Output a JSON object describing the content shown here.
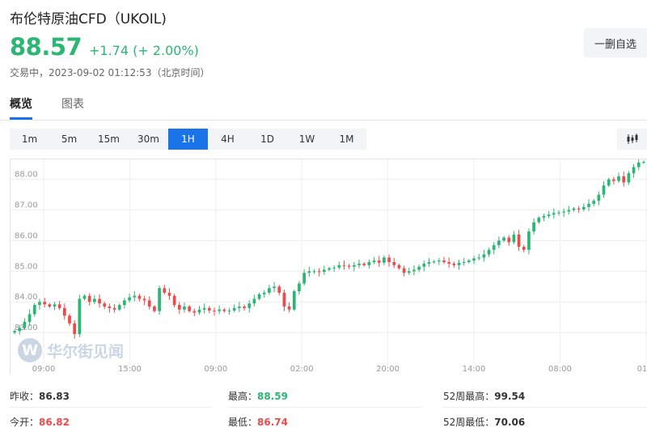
{
  "header": {
    "title": "布伦特原油CFD（UKOIL)",
    "price": "88.57",
    "change": "+1.74 (+ 2.00%)",
    "status": "交易中，2023-09-02 01:12:53（北京时间）",
    "watch_label": "一删自选"
  },
  "tabs": [
    {
      "label": "概览",
      "active": true
    },
    {
      "label": "图表",
      "active": false
    }
  ],
  "intervals": [
    {
      "label": "1m",
      "active": false
    },
    {
      "label": "5m",
      "active": false
    },
    {
      "label": "15m",
      "active": false
    },
    {
      "label": "30m",
      "active": false
    },
    {
      "label": "1H",
      "active": true
    },
    {
      "label": "4H",
      "active": false
    },
    {
      "label": "1D",
      "active": false
    },
    {
      "label": "1W",
      "active": false
    },
    {
      "label": "1M",
      "active": false
    }
  ],
  "chart_type_icon": "candlestick-chart-icon",
  "watermark": {
    "logo_letter": "W",
    "text": "华尔街见闻"
  },
  "colors": {
    "up": "#2bb673",
    "down": "#ef4a4a",
    "accent": "#1a73e8",
    "grid": "#eeeeee",
    "axis_text": "#999999"
  },
  "chart_data": {
    "type": "candlestick",
    "y_ticks": [
      "83.00",
      "84.00",
      "85.00",
      "86.00",
      "87.00",
      "88.00"
    ],
    "ylim": [
      82.0,
      88.6
    ],
    "x_ticks": [
      "09:00",
      "15:00",
      "09:00",
      "02:00",
      "20:00",
      "14:00",
      "08:00",
      "01:0"
    ],
    "grid": true,
    "closes": [
      83.05,
      83.15,
      83.35,
      83.6,
      83.9,
      84.0,
      83.92,
      83.85,
      83.92,
      83.8,
      83.55,
      83.3,
      82.95,
      84.1,
      84.2,
      84.0,
      84.1,
      83.95,
      83.85,
      83.8,
      83.75,
      83.9,
      84.05,
      84.15,
      84.2,
      84.1,
      84.05,
      83.85,
      83.7,
      84.45,
      84.3,
      84.2,
      83.9,
      83.75,
      83.85,
      83.7,
      83.65,
      83.75,
      83.8,
      83.72,
      83.7,
      83.75,
      83.7,
      83.72,
      83.8,
      83.85,
      83.8,
      83.95,
      84.1,
      84.25,
      84.3,
      84.45,
      84.5,
      84.3,
      83.85,
      83.75,
      84.35,
      84.6,
      84.95,
      85.0,
      85.0,
      84.98,
      85.05,
      85.1,
      85.12,
      85.2,
      85.18,
      85.15,
      85.2,
      85.25,
      85.2,
      85.3,
      85.35,
      85.28,
      85.45,
      85.3,
      85.2,
      85.1,
      84.95,
      85.0,
      85.05,
      85.15,
      85.25,
      85.3,
      85.32,
      85.35,
      85.3,
      85.25,
      85.2,
      85.28,
      85.3,
      85.35,
      85.42,
      85.45,
      85.55,
      85.7,
      85.85,
      86.0,
      86.1,
      85.95,
      86.2,
      85.8,
      85.7,
      86.3,
      86.6,
      86.75,
      86.8,
      86.85,
      86.9,
      86.92,
      86.95,
      87.0,
      87.05,
      87.02,
      87.1,
      87.2,
      87.3,
      87.5,
      87.8,
      88.0,
      87.95,
      88.1,
      87.9,
      88.2,
      88.4,
      88.55,
      88.57
    ]
  },
  "stats": {
    "prev_close_label": "昨收：",
    "prev_close": "86.83",
    "high_label": "最高：",
    "high": "88.59",
    "high52_label": "52周最高：",
    "high52": "99.54",
    "open_label": "今开：",
    "open": "86.82",
    "low_label": "最低：",
    "low": "86.74",
    "low52_label": "52周最低：",
    "low52": "70.06"
  }
}
